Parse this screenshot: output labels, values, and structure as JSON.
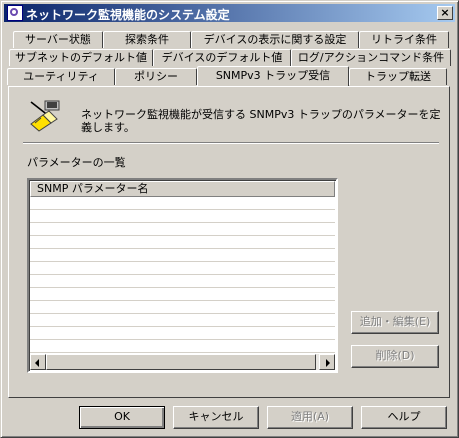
{
  "window": {
    "title": "ネットワーク監視機能のシステム設定",
    "close_glyph": "×"
  },
  "tabs": {
    "row1": [
      "サーバー状態",
      "探索条件",
      "デバイスの表示に関する設定",
      "リトライ条件"
    ],
    "row2": [
      "サブネットのデフォルト値",
      "デバイスのデフォルト値",
      "ログ/アクションコマンド条件"
    ],
    "row3": [
      "ユーティリティ",
      "ポリシー",
      "SNMPv3 トラップ受信",
      "トラップ転送"
    ],
    "active": "SNMPv3 トラップ受信"
  },
  "panel": {
    "description": "ネットワーク監視機能が受信する SNMPv3 トラップのパラメーターを定義します。",
    "list_title": "パラメーターの一覧",
    "column_header": "SNMP パラメーター名",
    "rows": [],
    "icon": "plug-connector-icon"
  },
  "side_buttons": {
    "add_edit": "追加・編集(E)",
    "delete": "削除(D)"
  },
  "footer_buttons": {
    "ok": "OK",
    "cancel": "キャンセル",
    "apply": "適用(A)",
    "help": "ヘルプ"
  }
}
